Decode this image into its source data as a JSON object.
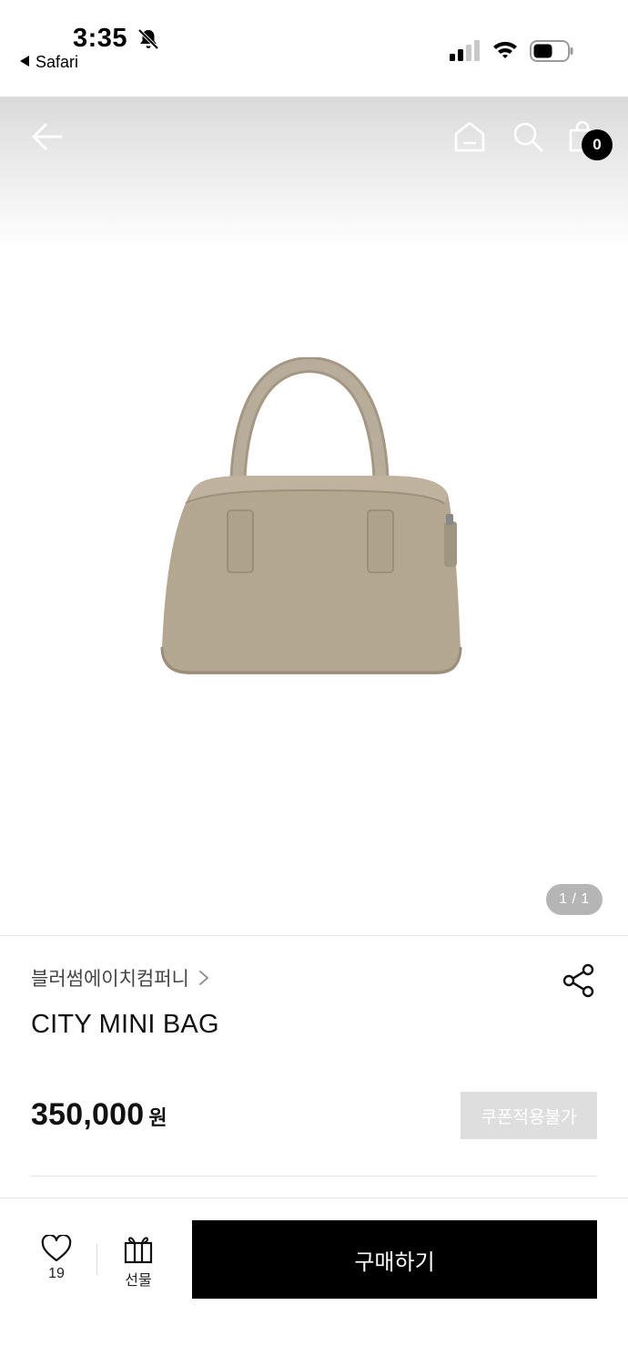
{
  "status_bar": {
    "time": "3:35",
    "back_app_label": "Safari"
  },
  "nav": {
    "cart_count": "0"
  },
  "gallery": {
    "page_indicator": "1 / 1"
  },
  "product": {
    "brand": "블러썸에이치컴퍼니",
    "name": "CITY MINI BAG",
    "price": "350,000",
    "currency": "원",
    "coupon_status": "쿠폰적용불가"
  },
  "bottom_bar": {
    "like_count": "19",
    "gift_label": "선물",
    "buy_label": "구매하기"
  }
}
